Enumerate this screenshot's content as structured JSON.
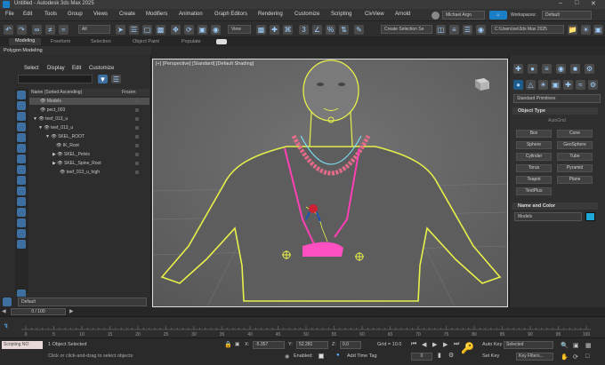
{
  "window": {
    "title": "Untitled - Autodesk 3ds Max 2025"
  },
  "menu": [
    "File",
    "Edit",
    "Tools",
    "Group",
    "Views",
    "Create",
    "Modifiers",
    "Animation",
    "Graph Editors",
    "Rendering",
    "Customize",
    "Scripting",
    "CivView",
    "Arnold"
  ],
  "user": {
    "name": "Michael Argo",
    "workspaces_label": "Workspaces:",
    "workspace": "Default"
  },
  "toolbar": {
    "filter": "All",
    "view_dropdown": "View",
    "selection_set": "Create Selection Se",
    "project_path": "C:\\Users\\se\\3ds Max 2025"
  },
  "ribbon": {
    "tabs": [
      "Modeling",
      "Freeform",
      "Selection",
      "Object Paint",
      "Populate"
    ],
    "active_tab": "Modeling",
    "sub_label": "Polygon Modeling"
  },
  "explorer": {
    "menu": [
      "Select",
      "Display",
      "Edit",
      "Customize"
    ],
    "header_name": "Name (Sorted Ascending)",
    "header_frozen": "Frozen",
    "rows": [
      {
        "label": "Models",
        "selected": true
      },
      {
        "label": "pect_003",
        "selected": false
      },
      {
        "label": "teef_013_u",
        "selected": false
      },
      {
        "label": "teef_013_u",
        "selected": false
      },
      {
        "label": "SKEL_ROOT",
        "selected": false
      },
      {
        "label": "IK_Root",
        "selected": false
      },
      {
        "label": "SKEL_Pelvis",
        "selected": false
      },
      {
        "label": "SKEL_Spine_Root",
        "selected": false
      },
      {
        "label": "teef_013_u_high",
        "selected": false
      }
    ],
    "layer": "Default"
  },
  "viewport": {
    "label": "[+] [Perspective] [Standard] [Default Shading]"
  },
  "command_panel": {
    "category": "Standard Primitives",
    "object_type_title": "Object Type",
    "autogrid": "AutoGrid",
    "buttons": [
      "Box",
      "Cone",
      "Sphere",
      "GeoSphere",
      "Cylinder",
      "Tube",
      "Torus",
      "Pyramid",
      "Teapot",
      "Plane",
      "TextPlus"
    ],
    "name_color_title": "Name and Color",
    "name_value": "Models",
    "color": "#1ea7d6"
  },
  "timeline": {
    "frame_display": "0 / 100",
    "ticks": [
      "0",
      "5",
      "10",
      "15",
      "20",
      "25",
      "30",
      "35",
      "40",
      "45",
      "50",
      "55",
      "60",
      "65",
      "70",
      "75",
      "80",
      "85",
      "90",
      "95",
      "100"
    ]
  },
  "status": {
    "script_label": "Scripting NO",
    "selected": "1 Object Selected",
    "prompt": "Click or click-and-drag to select objects",
    "x_label": "X:",
    "x_value": "-5.357",
    "y_label": "Y:",
    "y_value": "52.281",
    "z_label": "Z:",
    "z_value": "0.0",
    "grid": "Grid = 10.0",
    "enabled_label": "Enabled:",
    "add_time_tag": "Add Time Tag",
    "auto_key": "Auto Key",
    "selected_dropdown": "Selected",
    "set_key": "Set Key",
    "key_filters": "Key Filters...",
    "frame": "0"
  },
  "colors": {
    "selection_outline": "#e8f04a",
    "chain": "#e46c8a",
    "pendant": "#ff3fb4",
    "highlight_blue": "#1e90ff",
    "timeline_accent": "#5ab4ff"
  }
}
